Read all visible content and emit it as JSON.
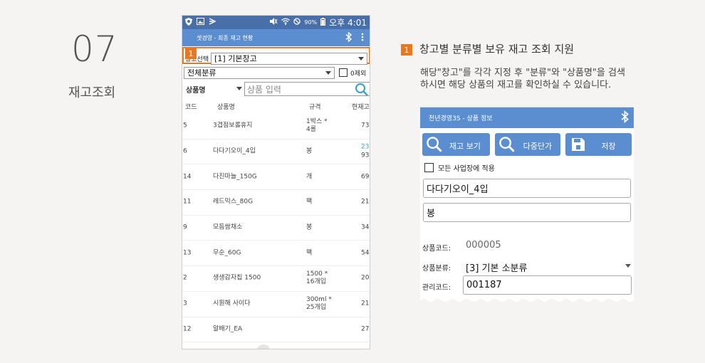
{
  "section": {
    "number": "07",
    "title": "재고조회"
  },
  "phone": {
    "status": {
      "signal": "90%",
      "time": "오후 4:01"
    },
    "app_title": "셋경영 - 최종 재고 현황",
    "badge": "1",
    "warehouse": {
      "label": "창고선택",
      "value": "[1] 기본창고"
    },
    "category": {
      "value": "전체분류",
      "exclude_zero_label": "0제외"
    },
    "search": {
      "mode": "상품명",
      "placeholder": "상품 입력"
    },
    "columns": [
      "코드",
      "상품명",
      "규격",
      "현재고"
    ],
    "rows": [
      {
        "code": "5",
        "name": "3겹점보롤휴지",
        "spec": "1박스 *\n4롤",
        "qty": "73",
        "qty_blue": ""
      },
      {
        "code": "6",
        "name": "다다기오이_4입",
        "spec": "봉",
        "qty": "93",
        "qty_blue": "23"
      },
      {
        "code": "14",
        "name": "다진마늘_150G",
        "spec": "개",
        "qty": "69",
        "qty_blue": ""
      },
      {
        "code": "11",
        "name": "레드믹스_80G",
        "spec": "팩",
        "qty": "21",
        "qty_blue": ""
      },
      {
        "code": "9",
        "name": "모듬쌈채소",
        "spec": "봉",
        "qty": "34",
        "qty_blue": ""
      },
      {
        "code": "13",
        "name": "무순_60G",
        "spec": "팩",
        "qty": "54",
        "qty_blue": ""
      },
      {
        "code": "2",
        "name": "생생감자칩 1500",
        "spec": "1500 *\n16개입",
        "qty": "20",
        "qty_blue": ""
      },
      {
        "code": "3",
        "name": "시원해 사이다",
        "spec": "300ml *\n25개입",
        "qty": "21",
        "qty_blue": ""
      },
      {
        "code": "12",
        "name": "알배기_EA",
        "spec": "",
        "qty": "27",
        "qty_blue": ""
      }
    ]
  },
  "description": {
    "badge": "1",
    "title": "창고별 분류별 보유 재고 조회 지원",
    "line1": "해당\"창고\"를 각각 지정 후 \"분류\"와 \"상품명\"을 검색",
    "line2": "하시면 해당 상품의 재고를 확인하실 수 있습니다."
  },
  "product_info": {
    "title": "천년경영3S - 상품 정보",
    "buttons": {
      "stock": "재고 보기",
      "multi_price": "다중단가",
      "save": "저장"
    },
    "apply_all_label": "모든 사업장에 적용",
    "name": "다다기오이_4입",
    "unit": "봉",
    "code_label": "상품코드:",
    "code_value": "000005",
    "category_label": "상품분류:",
    "category_value": "[3] 기본 소분류",
    "mgmt_label": "관리코드:",
    "mgmt_value": "001187"
  },
  "colors": {
    "accent": "#e8771f",
    "primary": "#5b8ed0",
    "status_bar": "#486fa9",
    "link_blue": "#3ba3d6"
  }
}
